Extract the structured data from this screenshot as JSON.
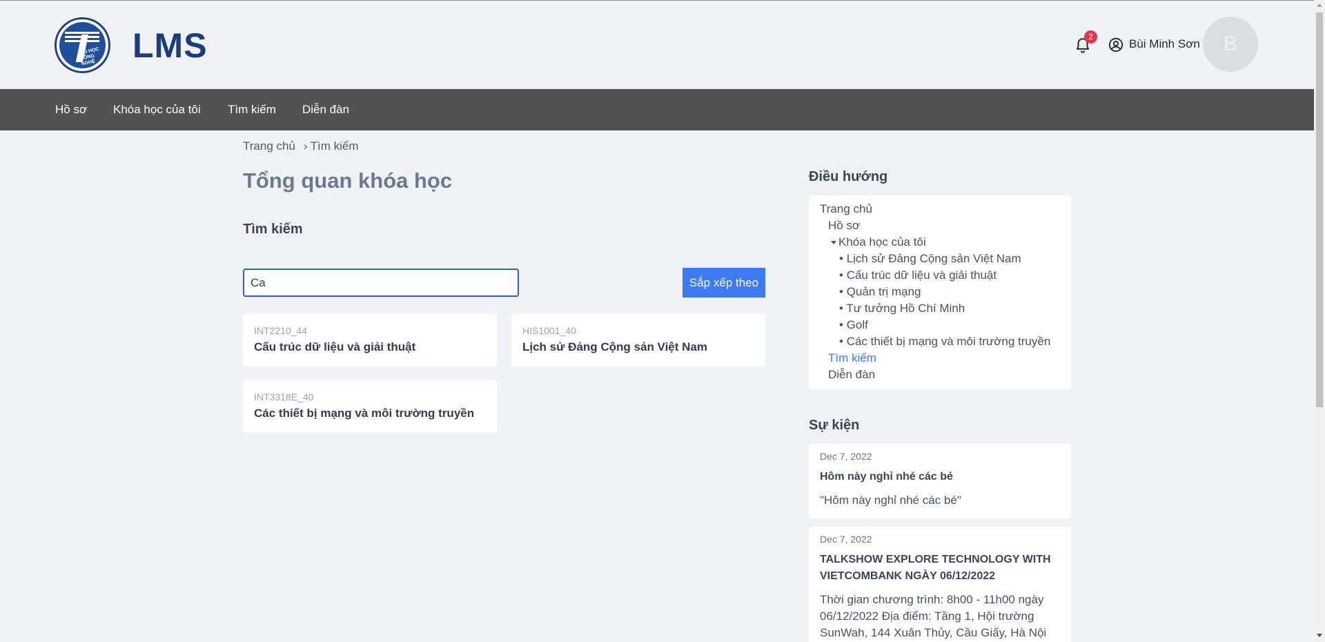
{
  "header": {
    "brand": "LMS",
    "logo_text": "ĐẠI HỌC CÔNG NGHỆ",
    "notification_count": "2",
    "user_name": "Bùi Minh Sơn",
    "avatar_initial": "B"
  },
  "nav": {
    "items": [
      {
        "label": "Hồ sơ"
      },
      {
        "label": "Khóa học của tôi"
      },
      {
        "label": "Tìm kiếm"
      },
      {
        "label": "Diễn đàn"
      }
    ]
  },
  "breadcrumb": {
    "home": "Trang chủ",
    "sep": "›",
    "current": "Tìm kiếm"
  },
  "main": {
    "title": "Tổng quan khóa học",
    "section_title": "Tìm kiếm",
    "search_value": "Ca",
    "sort_label": "Sắp xếp theo",
    "courses": [
      {
        "code": "INT2210_44",
        "name": "Cấu trúc dữ liệu và giải thuật"
      },
      {
        "code": "HIS1001_40",
        "name": "Lịch sử Đảng Cộng sản Việt Nam"
      },
      {
        "code": "INT3318E_40",
        "name": "Các thiết bị mạng và môi trường truyền"
      }
    ]
  },
  "sidebar": {
    "navigation_title": "Điều hướng",
    "navigation": [
      {
        "label": "Trang chủ"
      },
      {
        "label": "Hồ sơ"
      },
      {
        "label": "Khóa học của tôi"
      },
      {
        "label": "Lịch sử Đảng Cộng sản Việt Nam"
      },
      {
        "label": "Cấu trúc dữ liệu và giải thuật"
      },
      {
        "label": "Quản trị mạng"
      },
      {
        "label": "Tư tưởng Hồ Chí Minh"
      },
      {
        "label": "Golf"
      },
      {
        "label": "Các thiết bị mạng và môi trường truyền"
      },
      {
        "label": "Tìm kiếm"
      },
      {
        "label": "Diễn đàn"
      }
    ],
    "events_title": "Sự kiện",
    "events": [
      {
        "date": "Dec 7, 2022",
        "title": "Hôm này nghỉ nhé các bé",
        "desc": "\"Hôm này nghỉ nhé các bé\""
      },
      {
        "date": "Dec 7, 2022",
        "title": "TALKSHOW EXPLORE TECHNOLOGY WITH VIETCOMBANK NGÀY 06/12/2022",
        "desc": "Thời gian chương trình: 8h00 - 11h00 ngày 06/12/2022 Địa điểm: Tầng 1, Hội trường SunWah, 144 Xuân Thủy, Cầu Giấy, Hà Nội"
      }
    ]
  },
  "colors": {
    "navbar": "#525252",
    "accent": "#3d7af4",
    "brand": "#1b3d7a",
    "badge": "#e8334a"
  }
}
